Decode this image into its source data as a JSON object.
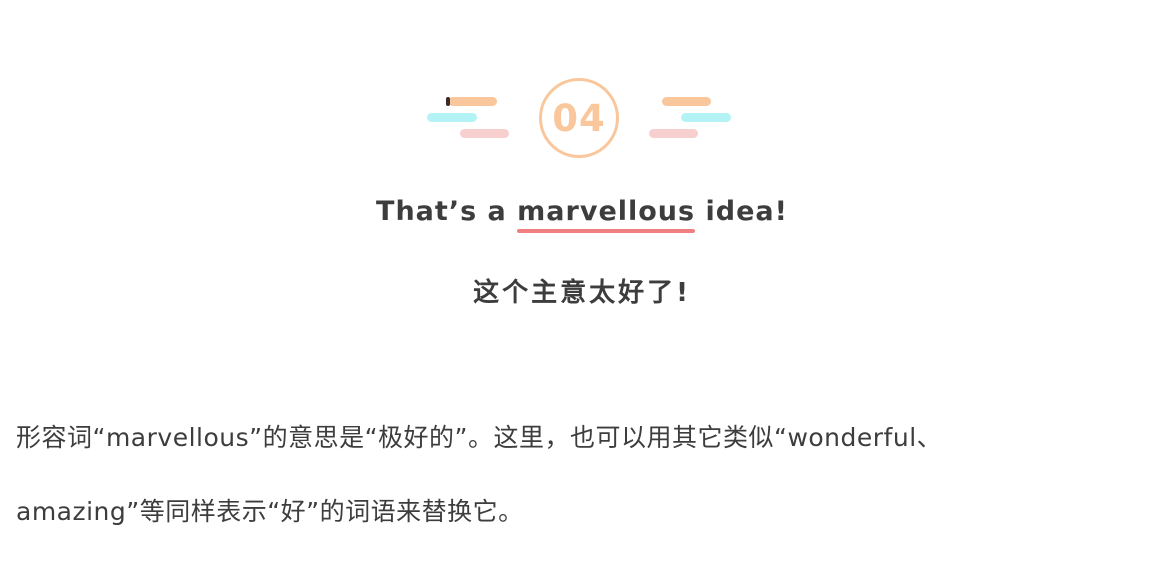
{
  "badge": {
    "number": "04",
    "colors": {
      "circle": "#f9c79b",
      "orange_line": "#f9c79b",
      "cyan_line": "#b3f3f5",
      "pink_line": "#f7cfcf",
      "underline": "#f08080",
      "text": "#3d3d3d"
    }
  },
  "title": {
    "en_before": "That’s a ",
    "en_keyword": "marvellous",
    "en_after": " idea!",
    "zh": "这个主意太好了!"
  },
  "explanation": {
    "line1": "形容词“marvellous”的意思是“极好的”。这里，也可以用其它类似“wonderful、",
    "line2": "amazing”等同样表示“好”的词语来替换它。"
  }
}
